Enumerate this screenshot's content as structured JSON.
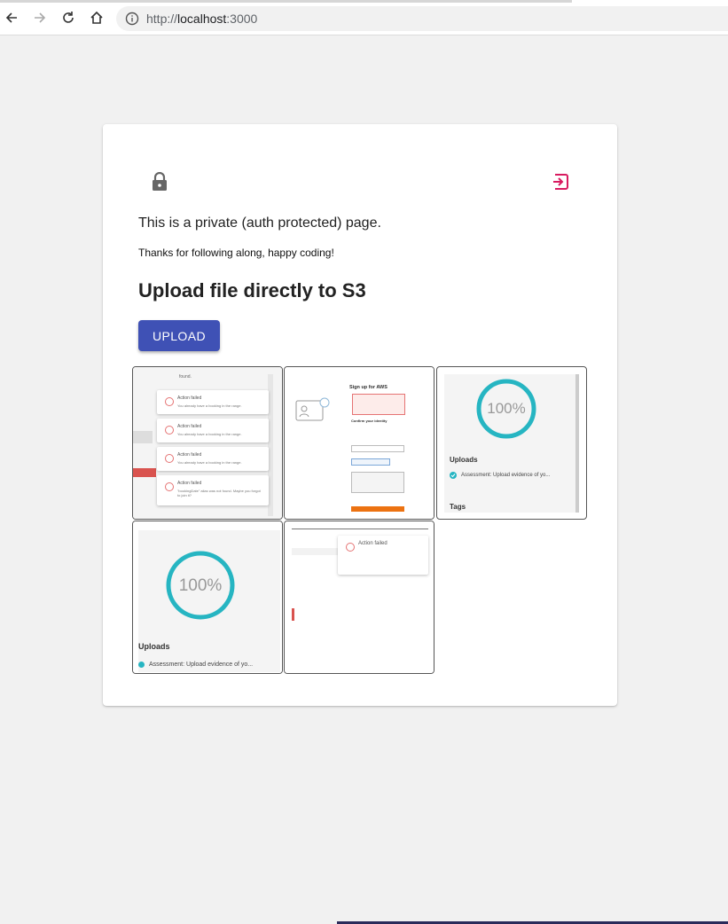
{
  "browser": {
    "url_scheme": "http://",
    "url_host": "localhost",
    "url_port": ":3000"
  },
  "page": {
    "private_text": "This is a private (auth protected) page.",
    "thanks_text": "Thanks for following along, happy coding!",
    "heading": "Upload file directly to S3",
    "upload_label": "UPLOAD"
  },
  "colors": {
    "primary": "#3f51b5",
    "logout": "#d81b60",
    "progress": "#26b5c2"
  },
  "thumbnails": [
    {
      "toasts": [
        {
          "title": "Action failed",
          "body": "You already have a booking in the range."
        },
        {
          "title": "Action failed",
          "body": "You already have a booking in the range."
        },
        {
          "title": "Action failed",
          "body": "You already have a booking in the range."
        },
        {
          "title": "Action failed",
          "body": "\"bookingDate\" alias was not found. Maybe you forgot to join it?"
        }
      ],
      "top_text": "found."
    },
    {
      "title": "Sign up for AWS",
      "subtitle": "Confirm your identity"
    },
    {
      "percent": "100%",
      "uploads_label": "Uploads",
      "item": "Assessment: Upload evidence of yo...",
      "tags_label": "Tags"
    },
    {
      "percent": "100%",
      "uploads_label": "Uploads",
      "item": "Assessment: Upload evidence of yo..."
    },
    {
      "title": "Action failed"
    }
  ]
}
